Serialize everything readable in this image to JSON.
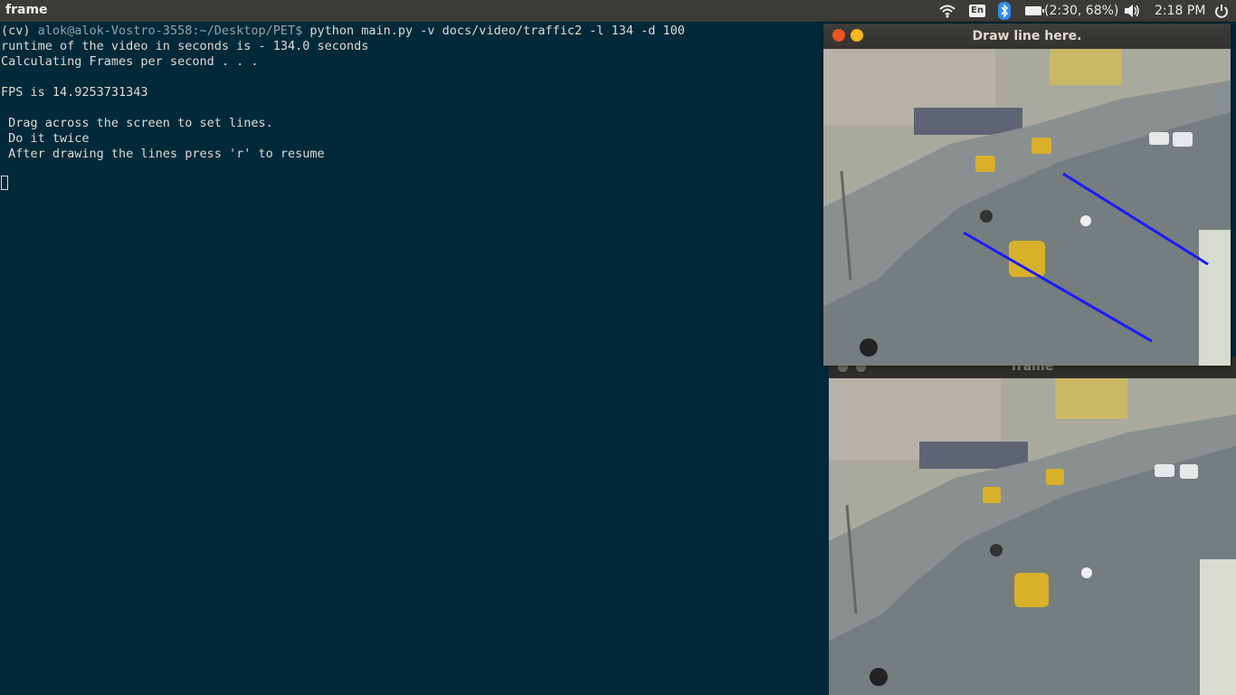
{
  "topbar": {
    "app_title": "frame",
    "keyboard_layout": "En",
    "battery_status": "(2:30, 68%)",
    "clock": "2:18 PM",
    "icons": [
      "wifi-icon",
      "keyboard-icon",
      "bluetooth-icon",
      "battery-icon",
      "volume-icon",
      "power-icon"
    ]
  },
  "terminal": {
    "prompt_env": "(cv) ",
    "prompt_user": "alok@alok-Vostro-3558",
    "prompt_path": ":~/Desktop/PET$ ",
    "command": "python main.py -v docs/video/traffic2 -l 134 -d 100",
    "output": [
      "runtime of the video in seconds is - 134.0 seconds",
      "Calculating Frames per second . . .",
      "",
      "FPS is 14.9253731343",
      "",
      " Drag across the screen to set lines.",
      " Do it twice",
      " After drawing the lines press 'r' to resume"
    ]
  },
  "windows": {
    "draw": {
      "title": "Draw line here."
    },
    "frame": {
      "title": "frame"
    }
  },
  "colors": {
    "terminal_bg": "#01293a",
    "drawn_line": "#1a1aff",
    "close_button": "#e95420",
    "minimize_button": "#f5b51b"
  }
}
